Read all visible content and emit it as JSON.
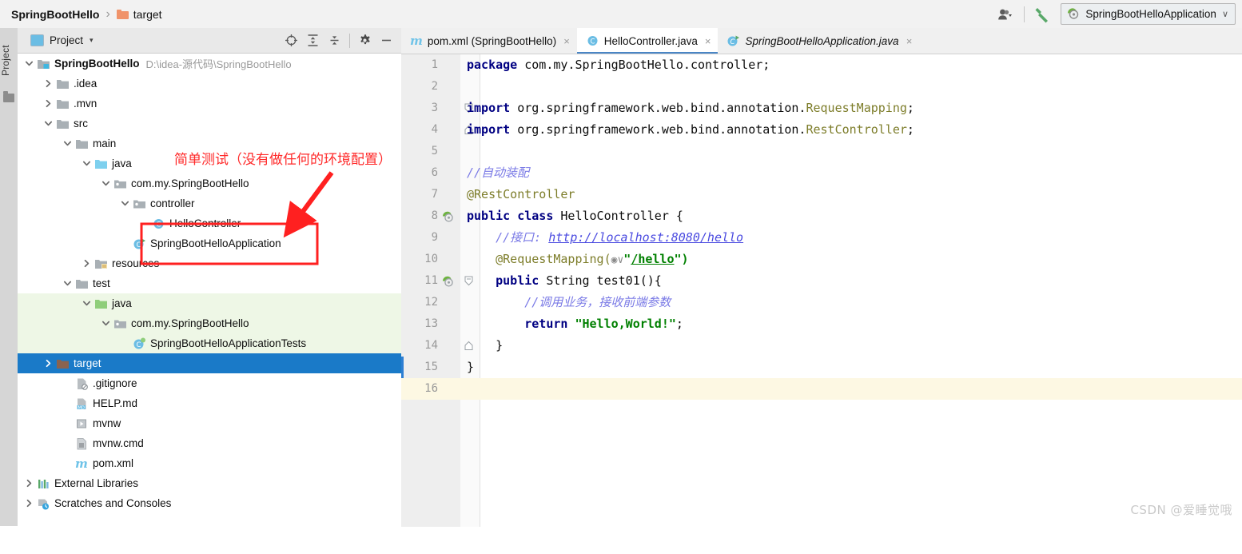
{
  "topbar": {
    "breadcrumb": {
      "project": "SpringBootHello",
      "separator": "›",
      "current": "target"
    },
    "user_icon": "user-icon",
    "build_icon": "build-hammer-icon",
    "run_config": {
      "label": "SpringBootHelloApplication",
      "chevron": "∨",
      "icon": "spring-boot-run-icon"
    }
  },
  "tool_strip": {
    "label": "Project",
    "icon": "folder-icon"
  },
  "project_panel": {
    "title": "Project",
    "caret": "▾",
    "tools": [
      {
        "name": "select-opened-file-icon",
        "glyph": "locate"
      },
      {
        "name": "expand-all-icon",
        "glyph": "expand"
      },
      {
        "name": "collapse-all-icon",
        "glyph": "collapse"
      },
      {
        "name": "settings-gear-icon",
        "glyph": "gear"
      },
      {
        "name": "hide-panel-icon",
        "glyph": "minus"
      }
    ],
    "tree": [
      {
        "id": "springboothello",
        "label": "SpringBootHello",
        "path": "D:\\idea-源代码\\SpringBootHello",
        "indent": 0,
        "arrow": "down",
        "icon": "module-folder-icon",
        "bold": true,
        "state": "normal"
      },
      {
        "id": "idea",
        "label": ".idea",
        "path": "",
        "indent": 1,
        "arrow": "right",
        "icon": "folder-grey-icon",
        "bold": false,
        "state": "normal"
      },
      {
        "id": "mvn",
        "label": ".mvn",
        "path": "",
        "indent": 1,
        "arrow": "right",
        "icon": "folder-grey-icon",
        "bold": false,
        "state": "normal"
      },
      {
        "id": "src",
        "label": "src",
        "path": "",
        "indent": 1,
        "arrow": "down",
        "icon": "folder-grey-icon",
        "bold": false,
        "state": "normal"
      },
      {
        "id": "main",
        "label": "main",
        "path": "",
        "indent": 2,
        "arrow": "down",
        "icon": "folder-grey-icon",
        "bold": false,
        "state": "normal"
      },
      {
        "id": "main-java",
        "label": "java",
        "path": "",
        "indent": 3,
        "arrow": "down",
        "icon": "source-root-blue-icon",
        "bold": false,
        "state": "normal"
      },
      {
        "id": "main-pkg",
        "label": "com.my.SpringBootHello",
        "path": "",
        "indent": 4,
        "arrow": "down",
        "icon": "package-icon",
        "bold": false,
        "state": "normal"
      },
      {
        "id": "controller",
        "label": "controller",
        "path": "",
        "indent": 5,
        "arrow": "down",
        "icon": "package-icon",
        "bold": false,
        "state": "normal"
      },
      {
        "id": "hellocontroller",
        "label": "HelloController",
        "path": "",
        "indent": 6,
        "arrow": "none",
        "icon": "java-class-icon",
        "bold": false,
        "state": "normal"
      },
      {
        "id": "springboothelloapplication",
        "label": "SpringBootHelloApplication",
        "path": "",
        "indent": 5,
        "arrow": "none",
        "icon": "java-class-run-icon",
        "bold": false,
        "state": "normal"
      },
      {
        "id": "resources",
        "label": "resources",
        "path": "",
        "indent": 3,
        "arrow": "right",
        "icon": "resource-root-icon",
        "bold": false,
        "state": "normal"
      },
      {
        "id": "test",
        "label": "test",
        "path": "",
        "indent": 2,
        "arrow": "down",
        "icon": "folder-grey-icon",
        "bold": false,
        "state": "normal"
      },
      {
        "id": "test-java",
        "label": "java",
        "path": "",
        "indent": 3,
        "arrow": "down",
        "icon": "test-root-green-icon",
        "bold": false,
        "state": "green"
      },
      {
        "id": "test-pkg",
        "label": "com.my.SpringBootHello",
        "path": "",
        "indent": 4,
        "arrow": "down",
        "icon": "package-icon",
        "bold": false,
        "state": "green"
      },
      {
        "id": "springboothelloapplicationtests",
        "label": "SpringBootHelloApplicationTests",
        "path": "",
        "indent": 5,
        "arrow": "none",
        "icon": "java-test-class-icon",
        "bold": false,
        "state": "green"
      },
      {
        "id": "target",
        "label": "target",
        "path": "",
        "indent": 1,
        "arrow": "right",
        "icon": "folder-excluded-icon",
        "bold": false,
        "state": "selected"
      },
      {
        "id": "gitignore",
        "label": ".gitignore",
        "path": "",
        "indent": 2,
        "arrow": "none",
        "icon": "gitignore-file-icon",
        "bold": false,
        "state": "normal"
      },
      {
        "id": "help-md",
        "label": "HELP.md",
        "path": "",
        "indent": 2,
        "arrow": "none",
        "icon": "markdown-file-icon",
        "bold": false,
        "state": "normal"
      },
      {
        "id": "mvnw",
        "label": "mvnw",
        "path": "",
        "indent": 2,
        "arrow": "none",
        "icon": "script-file-icon",
        "bold": false,
        "state": "normal"
      },
      {
        "id": "mvnw-cmd",
        "label": "mvnw.cmd",
        "path": "",
        "indent": 2,
        "arrow": "none",
        "icon": "cmd-file-icon",
        "bold": false,
        "state": "normal"
      },
      {
        "id": "pom-xml",
        "label": "pom.xml",
        "path": "",
        "indent": 2,
        "arrow": "none",
        "icon": "maven-file-icon",
        "bold": false,
        "state": "normal"
      },
      {
        "id": "external-libraries",
        "label": "External Libraries",
        "path": "",
        "indent": 0,
        "arrow": "right",
        "icon": "libraries-icon",
        "bold": false,
        "state": "normal"
      },
      {
        "id": "scratches",
        "label": "Scratches and Consoles",
        "path": "",
        "indent": 0,
        "arrow": "right",
        "icon": "scratches-icon",
        "bold": false,
        "state": "normal"
      }
    ]
  },
  "annotation": {
    "text": "简单测试（没有做任何的环境配置）",
    "color": "#ff2a2a"
  },
  "editor": {
    "tabs": [
      {
        "label": "pom.xml (SpringBootHello)",
        "icon": "maven-file-icon",
        "active": false,
        "italic": false,
        "close": "×"
      },
      {
        "label": "HelloController.java",
        "icon": "java-class-icon",
        "active": true,
        "italic": false,
        "close": "×"
      },
      {
        "label": "SpringBootHelloApplication.java",
        "icon": "java-class-run-icon",
        "active": false,
        "italic": true,
        "close": "×"
      }
    ],
    "current_line": 16,
    "lines": [
      {
        "n": 1,
        "gutter": "",
        "fold": "",
        "tokens": [
          {
            "t": "package ",
            "c": "kw"
          },
          {
            "t": "com.my.SpringBootHello.controller;",
            "c": "plain"
          }
        ]
      },
      {
        "n": 2,
        "gutter": "",
        "fold": "",
        "tokens": []
      },
      {
        "n": 3,
        "gutter": "",
        "fold": "fold-start",
        "tokens": [
          {
            "t": "import ",
            "c": "kw"
          },
          {
            "t": "org.springframework.web.bind.annotation.",
            "c": "plain"
          },
          {
            "t": "RequestMapping",
            "c": "cls"
          },
          {
            "t": ";",
            "c": "plain"
          }
        ]
      },
      {
        "n": 4,
        "gutter": "",
        "fold": "fold-end",
        "tokens": [
          {
            "t": "import ",
            "c": "kw"
          },
          {
            "t": "org.springframework.web.bind.annotation.",
            "c": "plain"
          },
          {
            "t": "RestController",
            "c": "cls"
          },
          {
            "t": ";",
            "c": "plain"
          }
        ]
      },
      {
        "n": 5,
        "gutter": "",
        "fold": "",
        "tokens": []
      },
      {
        "n": 6,
        "gutter": "",
        "fold": "",
        "tokens": [
          {
            "t": "//自动装配",
            "c": "cm"
          }
        ]
      },
      {
        "n": 7,
        "gutter": "",
        "fold": "",
        "tokens": [
          {
            "t": "@RestController",
            "c": "ann"
          }
        ]
      },
      {
        "n": 8,
        "gutter": "run-icon",
        "fold": "",
        "tokens": [
          {
            "t": "public class ",
            "c": "kw"
          },
          {
            "t": "HelloController ",
            "c": "plain"
          },
          {
            "t": "{",
            "c": "plain"
          }
        ]
      },
      {
        "n": 9,
        "gutter": "",
        "fold": "",
        "tokens": [
          {
            "t": "    //接口: ",
            "c": "cm"
          },
          {
            "t": "http://localhost:8080/hello",
            "c": "lnk"
          }
        ]
      },
      {
        "n": 10,
        "gutter": "",
        "fold": "",
        "tokens": [
          {
            "t": "    @RequestMapping(",
            "c": "ann"
          },
          {
            "t": "◉∨",
            "c": "globe"
          },
          {
            "t": "\"",
            "c": "str"
          },
          {
            "t": "/hello",
            "c": "lnk2"
          },
          {
            "t": "\")",
            "c": "str"
          }
        ]
      },
      {
        "n": 11,
        "gutter": "run-icon",
        "fold": "fold-start",
        "tokens": [
          {
            "t": "    public ",
            "c": "kw"
          },
          {
            "t": "String test01(){",
            "c": "plain"
          }
        ]
      },
      {
        "n": 12,
        "gutter": "",
        "fold": "",
        "tokens": [
          {
            "t": "        //调用业务，接收前端参数",
            "c": "cm"
          }
        ]
      },
      {
        "n": 13,
        "gutter": "",
        "fold": "",
        "tokens": [
          {
            "t": "        return ",
            "c": "kw"
          },
          {
            "t": "\"Hello,World!\"",
            "c": "str"
          },
          {
            "t": ";",
            "c": "plain"
          }
        ]
      },
      {
        "n": 14,
        "gutter": "",
        "fold": "fold-end",
        "tokens": [
          {
            "t": "    }",
            "c": "plain"
          }
        ]
      },
      {
        "n": 15,
        "gutter": "",
        "fold": "",
        "tokens": [
          {
            "t": "}",
            "c": "plain"
          }
        ]
      },
      {
        "n": 16,
        "gutter": "",
        "fold": "",
        "tokens": []
      }
    ]
  },
  "watermark": "CSDN @爱睡觉哦",
  "colors": {
    "selection_blue": "#1a7ac8",
    "test_green_bg": "#eef7e6",
    "current_line_yellow": "#fdf8e3",
    "annotation_red": "#ff2a2a",
    "keyword_navy": "#000082",
    "string_green": "#008000",
    "comment_purple": "#7a7ae6",
    "annotation_olive": "#7d7d2a"
  }
}
